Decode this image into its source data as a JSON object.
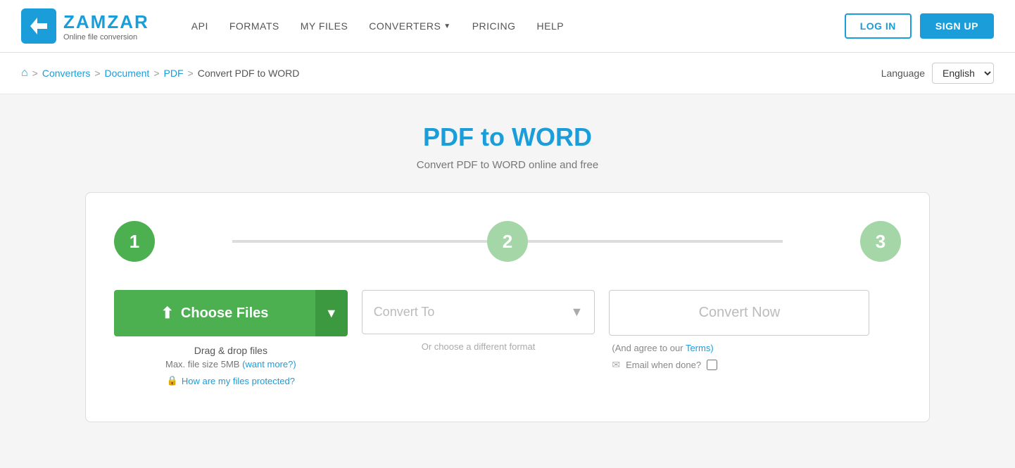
{
  "header": {
    "logo_title": "ZAMZAR",
    "logo_subtitle": "Online file conversion",
    "nav": {
      "api": "API",
      "formats": "FORMATS",
      "my_files": "MY FILES",
      "converters": "CONVERTERS",
      "pricing": "PRICING",
      "help": "HELP"
    },
    "login_label": "LOG IN",
    "signup_label": "SIGN UP"
  },
  "breadcrumb": {
    "home_label": "Home",
    "converters_label": "Converters",
    "document_label": "Document",
    "pdf_label": "PDF",
    "current_label": "Convert PDF to WORD",
    "language_label": "Language",
    "language_value": "English"
  },
  "main": {
    "title": "PDF to WORD",
    "subtitle": "Convert PDF to WORD online and free",
    "steps": {
      "step1": "1",
      "step2": "2",
      "step3": "3"
    },
    "choose_files": {
      "button_label": "Choose Files",
      "drag_text": "Drag & drop files",
      "file_size_text": "Max. file size 5MB",
      "want_more_label": "(want more?)",
      "protected_label": "How are my files protected?"
    },
    "convert_to": {
      "placeholder": "Convert To",
      "hint": "Or choose a different format"
    },
    "convert_now": {
      "button_label": "Convert Now",
      "terms_text": "(And agree to our",
      "terms_link": "Terms)",
      "email_label": "Email when done?"
    }
  }
}
